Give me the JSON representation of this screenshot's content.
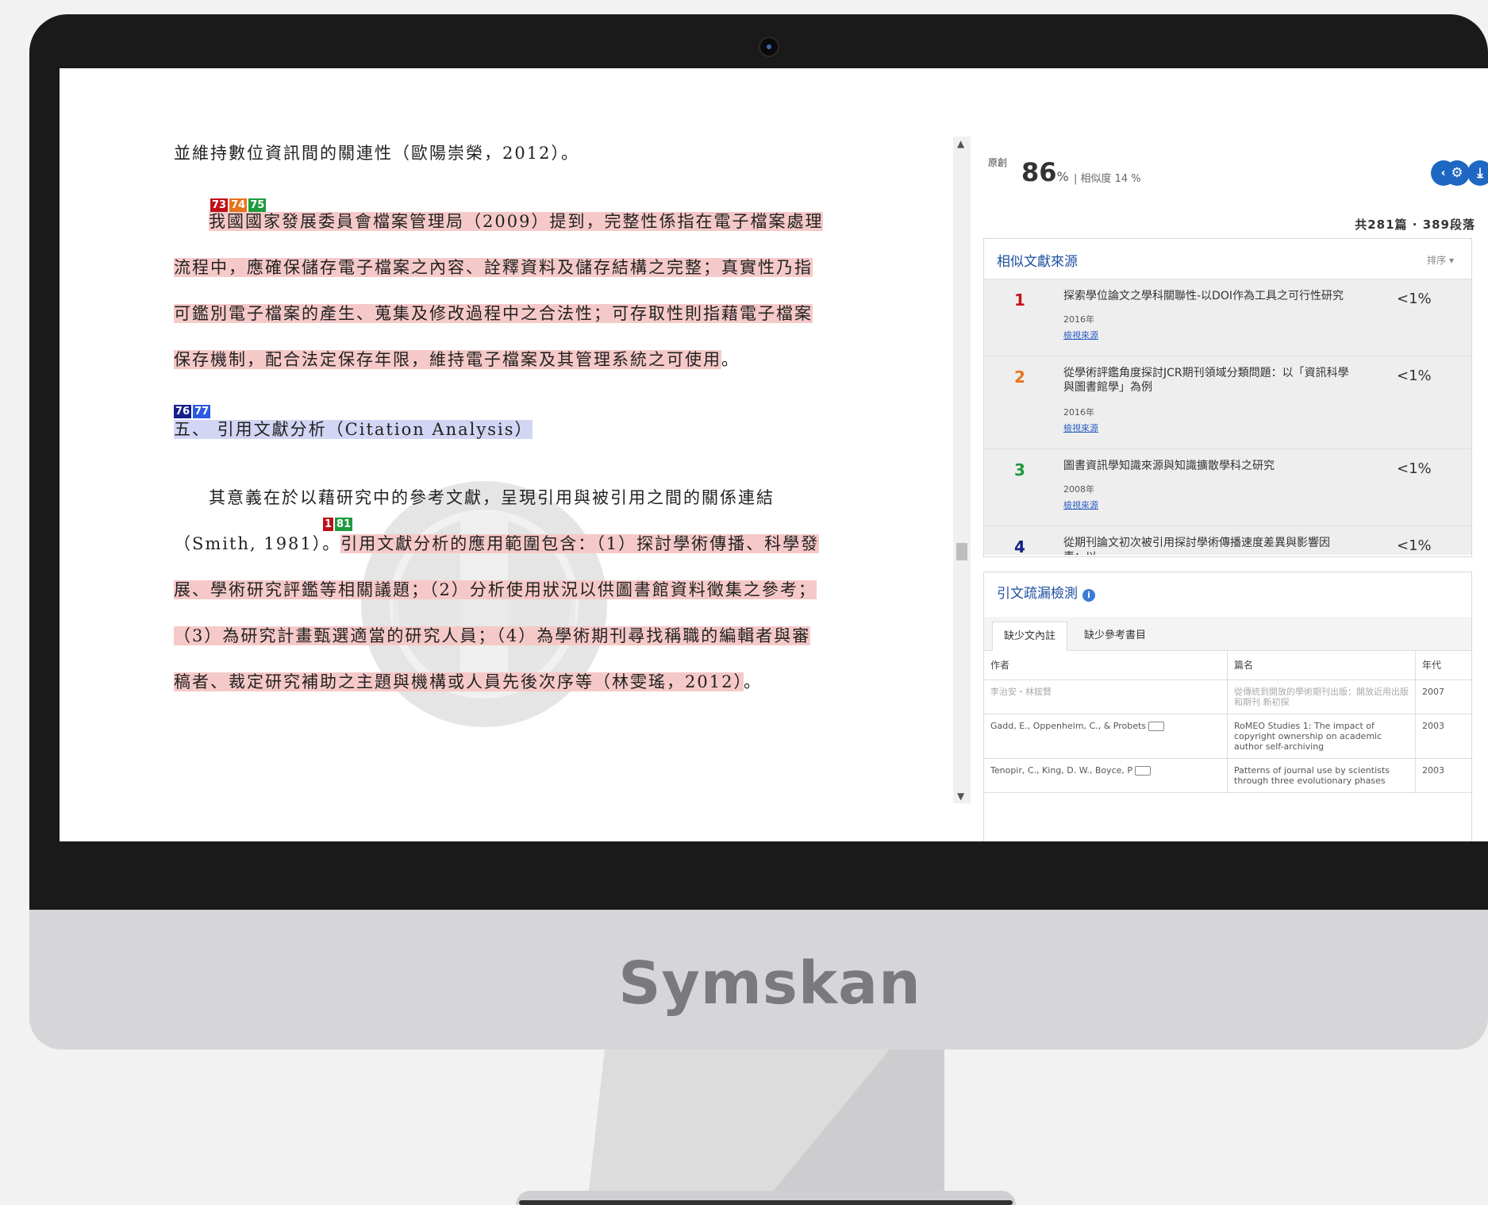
{
  "document": {
    "line0": "並維持數位資訊間的關連性（歐陽崇榮，2012）。",
    "badges1": [
      "73",
      "74",
      "75"
    ],
    "para1_lines": [
      "我國國家發展委員會檔案管理局（2009）提到，完整性係指在電子檔案處理",
      "流程中，應確保儲存電子檔案之內容、詮釋資料及儲存結構之完整；真實性乃指",
      "可鑑別電子檔案的產生、蒐集及修改過程中之合法性；可存取性則指藉電子檔案",
      "保存機制，配合法定保存年限，維持電子檔案及其管理系統之可使用"
    ],
    "para1_end": "。",
    "badges2": [
      "76",
      "77"
    ],
    "heading": "五、 引用文獻分析（Citation Analysis）",
    "para2_line1": "其意義在於以藉研究中的參考文獻，呈現引用與被引用之間的關係連結",
    "badges3": [
      "1",
      "81"
    ],
    "para2_line2_plain": "（Smith, 1981）。",
    "para2_line2_hl": "引用文獻分析的應用範圍包含：（1）探討學術傳播、科學發",
    "para2_lines_hl": [
      "展、學術研究評鑑等相關議題；（2）分析使用狀況以供圖書館資料徵集之參考；",
      "（3）為研究計畫甄選適當的研究人員；（4）為學術期刊尋找稱職的編輯者與審",
      "稿者、裁定研究補助之主題與機構或人員先後次序等（林雯瑤，2012）"
    ],
    "para2_end": "。"
  },
  "panel": {
    "original_label": "原創",
    "original_value": "86",
    "original_unit": "%",
    "similarity_text": "|  相似度 14 %",
    "totals": "共281篇 · 389段落",
    "similar_sources_title": "相似文獻來源",
    "sort_label": "排序 ▾",
    "sources": [
      {
        "rank": "1",
        "title": "探索學位論文之學科關聯性-以DOI作為工具之可行性研究",
        "year": "2016年",
        "link": "檢視來源",
        "pct": "<1%",
        "color": "#c8141c"
      },
      {
        "rank": "2",
        "title": "從學術評鑑角度探討JCR期刊領域分類問題：以「資訊科學與圖書館學」為例",
        "year": "2016年",
        "link": "檢視來源",
        "pct": "<1%",
        "color": "#e8731a"
      },
      {
        "rank": "3",
        "title": "圖書資訊學知識來源與知識擴散學科之研究",
        "year": "2008年",
        "link": "檢視來源",
        "pct": "<1%",
        "color": "#1f9a3f"
      },
      {
        "rank": "4",
        "title": "從期刊論文初次被引用探討學術傳播速度差異與影響因素：以",
        "year": "",
        "link": "",
        "pct": "<1%",
        "color": "#16208a"
      }
    ],
    "missing_title": "引文疏漏檢測",
    "tabs": [
      "缺少文內註",
      "缺少參考書目"
    ],
    "table_headers": [
      "作者",
      "篇名",
      "年代"
    ],
    "table_rows": [
      {
        "author": "李治安・林鋐賢",
        "title": "從傳統到開放的學術期刊出版：開放近用出版和期刊 新初探",
        "year": "2007"
      },
      {
        "author": "Gadd, E., Oppenheim, C., & Probets",
        "title": "RoMEO Studies 1: The impact of copyright ownership on academic author self-archiving",
        "year": "2003"
      },
      {
        "author": "Tenopir, C., King, D. W., Boyce, P",
        "title": "Patterns of journal use by scientists through three evolutionary phases",
        "year": "2003"
      }
    ]
  },
  "brand": "Symskan"
}
